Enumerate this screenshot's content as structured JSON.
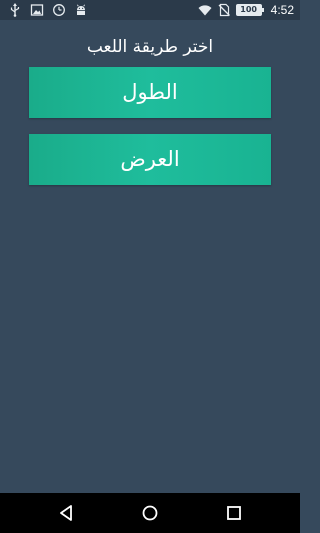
{
  "status_bar": {
    "left_icons": [
      "usb-icon",
      "image-icon",
      "clock-icon",
      "android-icon"
    ],
    "right_icons": [
      "wifi-icon",
      "no-sim-icon",
      "battery-icon"
    ],
    "battery_level": "100",
    "time": "4:52"
  },
  "game": {
    "prompt": "اختر طريقة اللعب",
    "options": [
      {
        "label": "الطول"
      },
      {
        "label": "العرض"
      }
    ],
    "accent_color": "#1fb697",
    "background_color": "#36495c"
  },
  "nav_bar": {
    "icons": [
      "back-icon",
      "home-icon",
      "recent-apps-icon"
    ]
  }
}
